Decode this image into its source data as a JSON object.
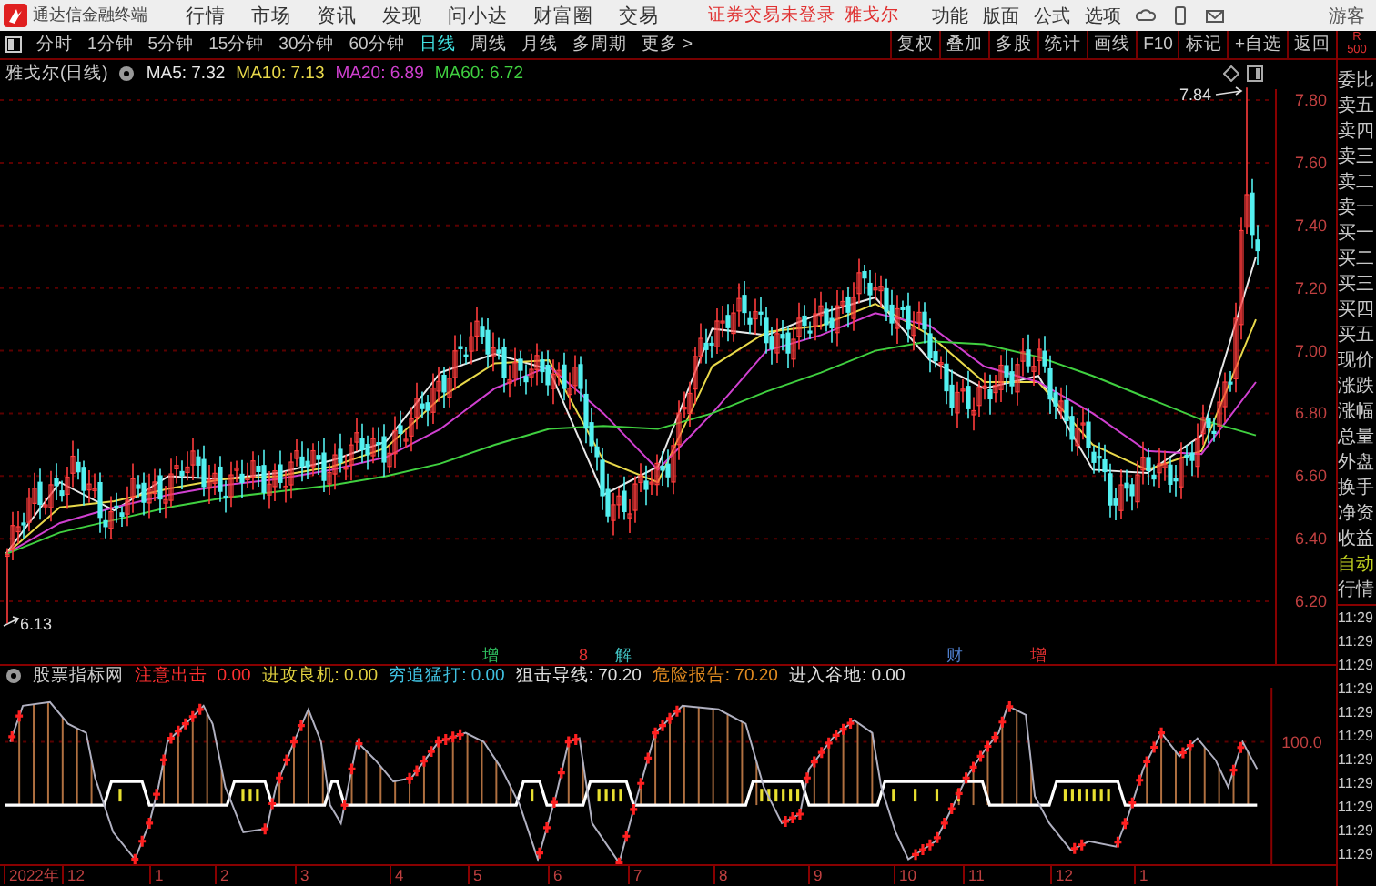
{
  "app": {
    "name": "通达信金融终端"
  },
  "menu": [
    "行情",
    "市场",
    "资讯",
    "发现",
    "问小达",
    "财富圈",
    "交易"
  ],
  "login_status": "证券交易未登录",
  "stock_name": "雅戈尔",
  "right_menu": [
    "功能",
    "版面",
    "公式",
    "选项"
  ],
  "user": "游客",
  "periods": [
    {
      "label": "分时",
      "selected": false
    },
    {
      "label": "1分钟",
      "selected": false
    },
    {
      "label": "5分钟",
      "selected": false
    },
    {
      "label": "15分钟",
      "selected": false
    },
    {
      "label": "30分钟",
      "selected": false
    },
    {
      "label": "60分钟",
      "selected": false
    },
    {
      "label": "日线",
      "selected": true
    },
    {
      "label": "周线",
      "selected": false
    },
    {
      "label": "月线",
      "selected": false
    },
    {
      "label": "多周期",
      "selected": false
    },
    {
      "label": "更多 >",
      "selected": false
    }
  ],
  "tools": [
    "复权",
    "叠加",
    "多股",
    "统计",
    "画线",
    "F10",
    "标记",
    "+自选",
    "返回"
  ],
  "corner": {
    "line1": "R",
    "line2": "500"
  },
  "main_chart": {
    "title": "雅戈尔(日线)",
    "ma_readings": [
      ": 7.32",
      ": 7.13",
      ": 6.89",
      ": 6.72"
    ],
    "chart_data": {
      "type": "line",
      "grid": true,
      "series": [
        {
          "name": "MA5",
          "color": "#e8e8e8",
          "values": [
            6.35,
            6.58,
            6.49,
            6.6,
            6.59,
            6.61,
            6.65,
            6.71,
            6.93,
            6.99,
            6.94,
            6.54,
            6.63,
            7.07,
            7.05,
            7.12,
            7.17,
            6.97,
            6.88,
            6.92,
            6.62,
            6.61,
            6.73,
            7.3
          ]
        },
        {
          "name": "MA10",
          "color": "#e8d84a",
          "values": [
            6.35,
            6.5,
            6.52,
            6.56,
            6.59,
            6.6,
            6.63,
            6.69,
            6.85,
            6.96,
            6.97,
            6.65,
            6.58,
            6.95,
            7.06,
            7.08,
            7.15,
            7.05,
            6.9,
            6.9,
            6.7,
            6.62,
            6.68,
            7.1
          ]
        },
        {
          "name": "MA20",
          "color": "#d040d0",
          "values": [
            6.35,
            6.45,
            6.5,
            6.54,
            6.57,
            6.59,
            6.62,
            6.66,
            6.75,
            6.88,
            6.95,
            6.8,
            6.62,
            6.8,
            7.0,
            7.05,
            7.12,
            7.08,
            6.95,
            6.9,
            6.8,
            6.68,
            6.67,
            6.9
          ]
        },
        {
          "name": "MA60",
          "color": "#40d040",
          "values": [
            6.35,
            6.42,
            6.46,
            6.5,
            6.53,
            6.55,
            6.57,
            6.6,
            6.64,
            6.7,
            6.75,
            6.76,
            6.75,
            6.8,
            6.87,
            6.93,
            7.0,
            7.03,
            7.02,
            6.98,
            6.92,
            6.85,
            6.78,
            6.73
          ]
        }
      ],
      "ylim": [
        6.0,
        7.835
      ],
      "yticks": [
        {
          "value": 7.8,
          "label": "7.80"
        },
        {
          "value": 7.6,
          "label": "7.60"
        },
        {
          "value": 7.4,
          "label": "7.40"
        },
        {
          "value": 7.2,
          "label": "7.20"
        },
        {
          "value": 7.0,
          "label": "7.00"
        },
        {
          "value": 6.8,
          "label": "6.80"
        },
        {
          "value": 6.6,
          "label": "6.60"
        },
        {
          "value": 6.4,
          "label": "6.40"
        },
        {
          "value": 6.2,
          "label": "6.20"
        }
      ]
    },
    "high_label": "7.84",
    "low_label": "6.13"
  },
  "events": [
    {
      "label": "增",
      "color": "#30c060"
    },
    {
      "label": "8",
      "color": "#e03030"
    },
    {
      "label": "解",
      "color": "#40c0c0"
    },
    {
      "label": "财",
      "color": "#5080d0"
    },
    {
      "label": "增",
      "color": "#e03030"
    }
  ],
  "indicator": {
    "name": "股票指标网",
    "values": [
      {
        "label": "注意出击  0.00",
        "color": "#ff3030"
      },
      {
        "label": "进攻良机: 0.00",
        "color": "#e0d040"
      },
      {
        "label": "穷追猛打: 0.00",
        "color": "#40c0e0"
      },
      {
        "label": "狙击导线: 70.20",
        "color": "#e0e0e0"
      },
      {
        "label": "危险报告: 70.20",
        "color": "#e08a20"
      },
      {
        "label": "进入谷地: 0.00",
        "color": "#e0e0e0"
      }
    ],
    "ytick": "100.0"
  },
  "x_axis": [
    "2022年",
    "12",
    "1",
    "2",
    "3",
    "4",
    "5",
    "6",
    "7",
    "8",
    "9",
    "10",
    "11",
    "12",
    "1"
  ],
  "quote_panel": {
    "fields": [
      "委比",
      "卖五",
      "卖四",
      "卖三",
      "卖二",
      "卖一",
      "买一",
      "买二",
      "买三",
      "买四",
      "买五",
      "现价",
      "涨跌",
      "涨幅",
      "总量",
      "外盘",
      "换手",
      "净资",
      "收益"
    ],
    "auto_button": "自动",
    "section": "行情",
    "times": [
      "11:29",
      "11:29",
      "11:29",
      "11:29",
      "11:29",
      "11:29",
      "11:29",
      "11:29",
      "11:29",
      "11:29",
      "11:29"
    ]
  }
}
